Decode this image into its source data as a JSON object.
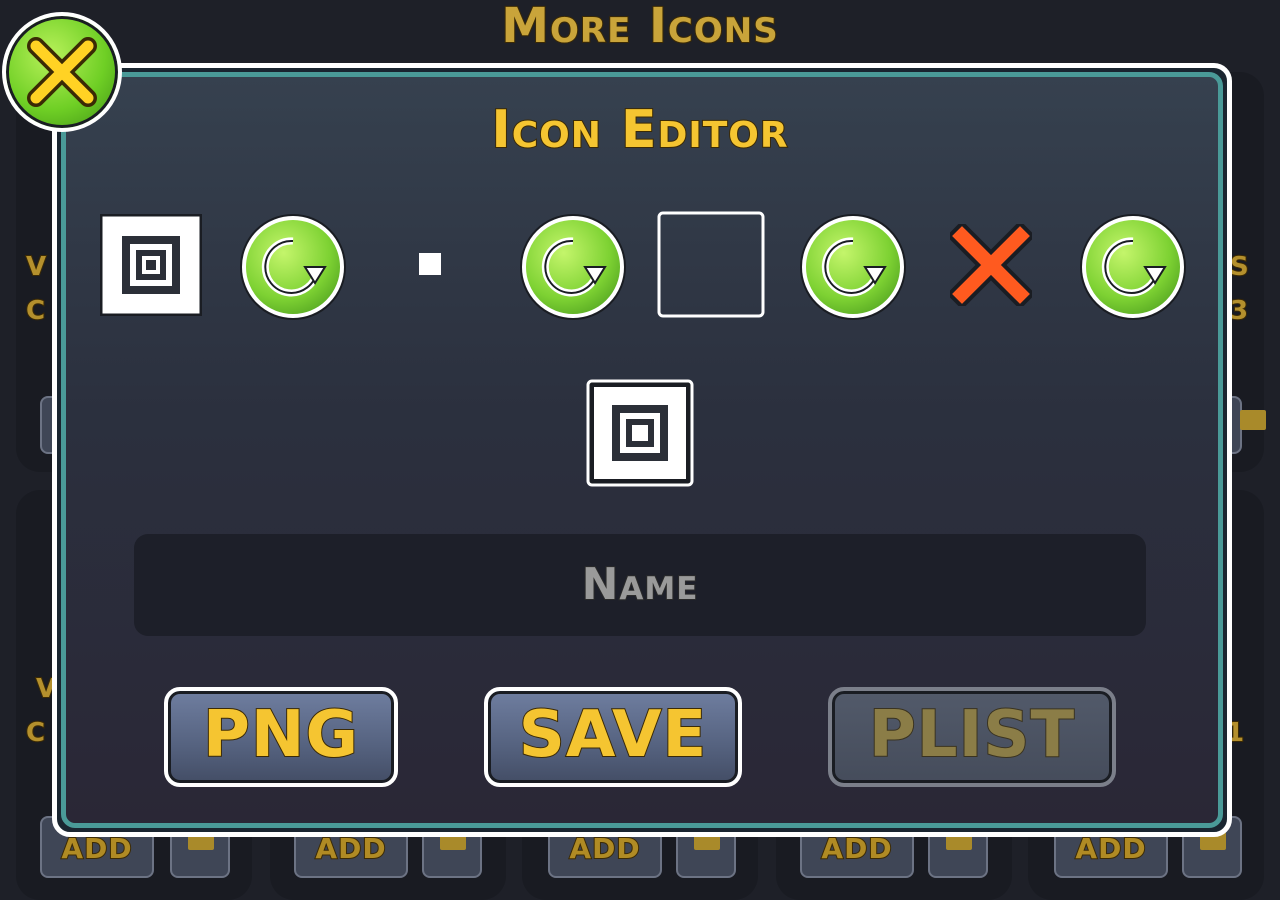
{
  "background": {
    "title": "More Icons",
    "side_left": [
      "V",
      "C",
      "V",
      "C"
    ],
    "side_right": [
      "S",
      "3",
      "1"
    ],
    "add_label": "ADD"
  },
  "dialog": {
    "title": "Icon Editor",
    "name_placeholder": "Name",
    "buttons": {
      "png": "PNG",
      "save": "SAVE",
      "plist": "PLIST"
    },
    "layers": [
      {
        "icon": "square-icon",
        "rotate": "rotate-icon"
      },
      {
        "icon": "small-dot-icon",
        "rotate": "rotate-icon"
      },
      {
        "icon": "empty-outline-icon",
        "rotate": "rotate-icon"
      },
      {
        "icon": "remove-x-icon",
        "rotate": "rotate-icon"
      }
    ],
    "preview_icon": "cube-preview-icon"
  },
  "colors": {
    "accent": "#f5c531",
    "green": "#7ed233",
    "teal_border": "#4a9a98",
    "red_x": "#ff5a1f"
  }
}
